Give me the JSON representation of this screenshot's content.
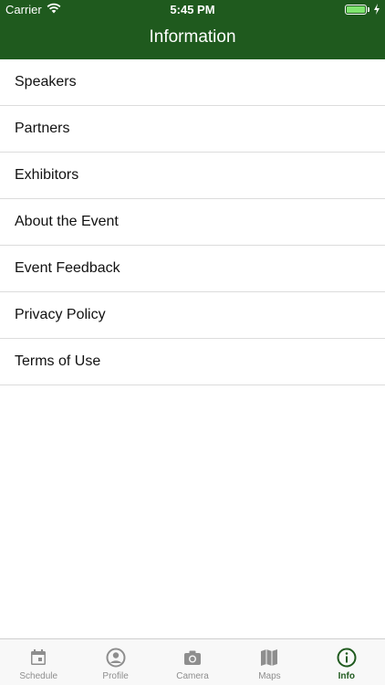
{
  "status_bar": {
    "carrier": "Carrier",
    "time": "5:45 PM"
  },
  "header": {
    "title": "Information"
  },
  "menu": [
    {
      "label": "Speakers"
    },
    {
      "label": "Partners"
    },
    {
      "label": "Exhibitors"
    },
    {
      "label": "About the Event"
    },
    {
      "label": "Event Feedback"
    },
    {
      "label": "Privacy Policy"
    },
    {
      "label": "Terms of Use"
    }
  ],
  "tabs": [
    {
      "label": "Schedule",
      "icon": "calendar-icon"
    },
    {
      "label": "Profile",
      "icon": "user-icon"
    },
    {
      "label": "Camera",
      "icon": "camera-icon"
    },
    {
      "label": "Maps",
      "icon": "map-icon"
    },
    {
      "label": "Info",
      "icon": "info-icon",
      "active": true
    }
  ],
  "colors": {
    "primary": "#1f5a1e",
    "inactive": "#8e8e8e"
  }
}
